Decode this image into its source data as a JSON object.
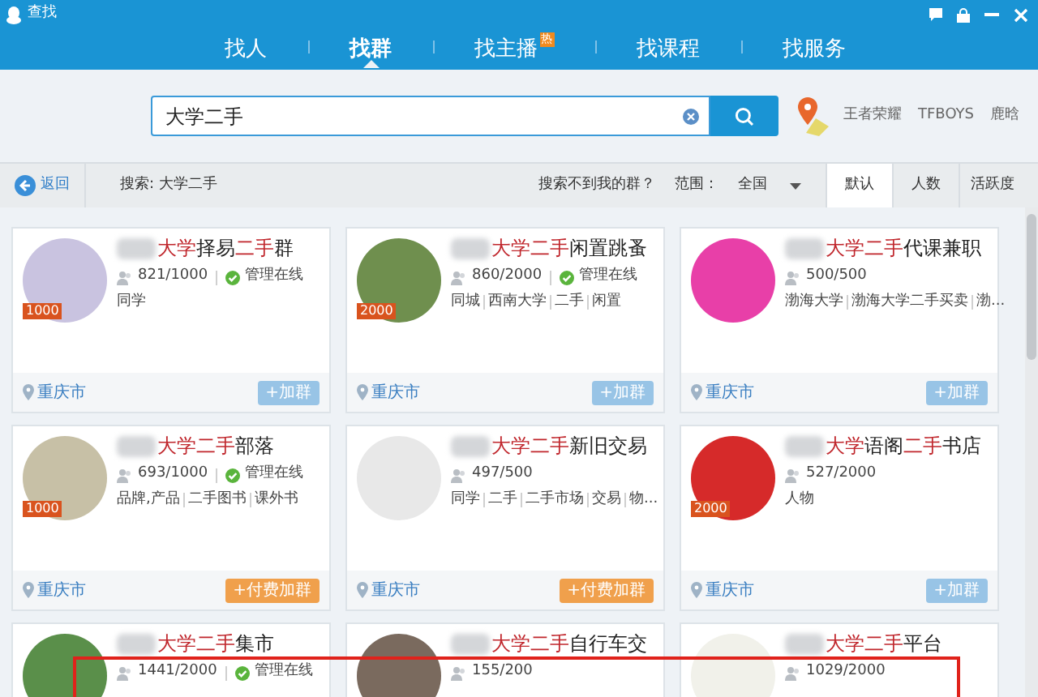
{
  "window": {
    "title": "查找"
  },
  "tabs": [
    {
      "label": "找人",
      "selected": false
    },
    {
      "label": "找群",
      "selected": true
    },
    {
      "label": "找主播",
      "selected": false,
      "badge": "热"
    },
    {
      "label": "找课程",
      "selected": false
    },
    {
      "label": "找服务",
      "selected": false
    }
  ],
  "search": {
    "value": "大学二手"
  },
  "hot_words": [
    "王者荣耀",
    "TFBOYS",
    "鹿晗"
  ],
  "toolbar": {
    "back": "返回",
    "query": "搜索: 大学二手",
    "help": "搜索不到我的群？",
    "range_label": "范围：",
    "range_value": "全国",
    "sort_tabs": [
      {
        "label": "默认",
        "selected": true
      },
      {
        "label": "人数",
        "selected": false
      },
      {
        "label": "活跃度",
        "selected": false
      }
    ]
  },
  "groups": [
    {
      "title": [
        {
          "text": "大学",
          "highlight": true
        },
        {
          "text": "择易",
          "highlight": false
        },
        {
          "text": "二手",
          "highlight": true
        },
        {
          "text": "群",
          "highlight": false
        }
      ],
      "level_badge": "1000",
      "members": "821/1000",
      "admin_label": "管理在线",
      "tags": [
        "同学"
      ],
      "location": "重庆市",
      "join": {
        "label": "+加群",
        "kind": "free"
      }
    },
    {
      "title": [
        {
          "text": "大学二手",
          "highlight": true
        },
        {
          "text": "闲置跳蚤",
          "highlight": false
        }
      ],
      "level_badge": "2000",
      "members": "860/2000",
      "admin_label": "管理在线",
      "tags": [
        "同城",
        "西南大学",
        "二手",
        "闲置"
      ],
      "location": "重庆市",
      "join": {
        "label": "+加群",
        "kind": "free"
      }
    },
    {
      "title": [
        {
          "text": "大学二手",
          "highlight": true
        },
        {
          "text": "代课兼职",
          "highlight": false
        }
      ],
      "members": "500/500",
      "tags": [
        "渤海大学",
        "渤海大学二手买卖",
        "渤..."
      ],
      "location": "重庆市",
      "join": {
        "label": "+加群",
        "kind": "free"
      }
    },
    {
      "title": [
        {
          "text": "大学二手",
          "highlight": true
        },
        {
          "text": "部落",
          "highlight": false
        }
      ],
      "level_badge": "1000",
      "members": "693/1000",
      "admin_label": "管理在线",
      "tags": [
        "品牌,产品",
        "二手图书",
        "课外书"
      ],
      "location": "重庆市",
      "join": {
        "label": "+付费加群",
        "kind": "paid"
      }
    },
    {
      "title": [
        {
          "text": "大学二手",
          "highlight": true
        },
        {
          "text": "新旧交易",
          "highlight": false
        }
      ],
      "members": "497/500",
      "tags": [
        "同学",
        "二手",
        "二手市场",
        "交易",
        "物..."
      ],
      "location": "重庆市",
      "join": {
        "label": "+付费加群",
        "kind": "paid"
      }
    },
    {
      "title": [
        {
          "text": "大学",
          "highlight": true
        },
        {
          "text": "语阁",
          "highlight": false
        },
        {
          "text": "二手",
          "highlight": true
        },
        {
          "text": "书店",
          "highlight": false
        }
      ],
      "level_badge": "2000",
      "members": "527/2000",
      "tags": [
        "人物"
      ],
      "location": "重庆市",
      "join": {
        "label": "+加群",
        "kind": "free"
      }
    },
    {
      "title": [
        {
          "text": "大学二手",
          "highlight": true
        },
        {
          "text": "集市",
          "highlight": false
        }
      ],
      "members": "1441/2000",
      "admin_label": "管理在线"
    },
    {
      "title": [
        {
          "text": "大学二手",
          "highlight": true
        },
        {
          "text": "自行车交",
          "highlight": false
        }
      ],
      "members": "155/200"
    },
    {
      "title": [
        {
          "text": "大学二手",
          "highlight": true
        },
        {
          "text": "平台",
          "highlight": false
        }
      ],
      "members": "1029/2000"
    }
  ]
}
